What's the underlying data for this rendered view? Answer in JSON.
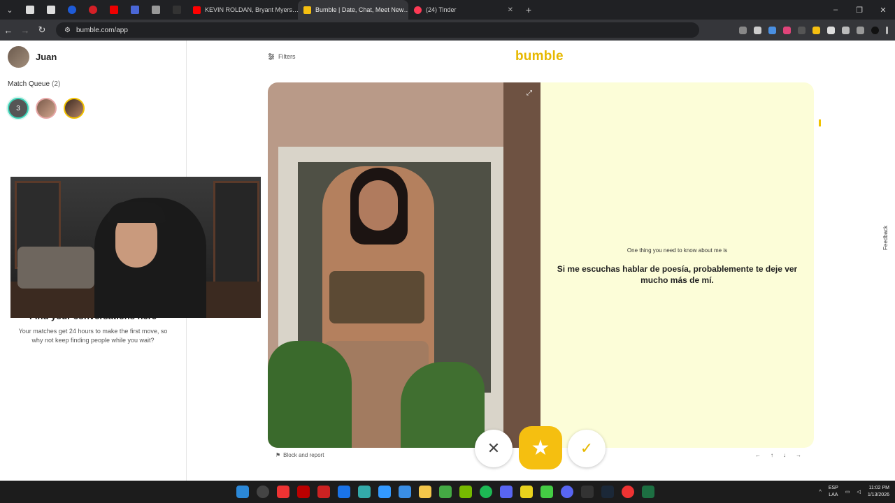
{
  "browser": {
    "tabs": [
      {
        "title": "KEVIN ROLDAN, Bryant Myers…",
        "color": "#ff0000",
        "active": false
      },
      {
        "title": "Bumble | Date, Chat, Meet New…",
        "color": "#f5bf10",
        "active": true
      },
      {
        "title": "(24) Tinder",
        "color": "#fd3a55",
        "active": false
      }
    ],
    "url": "bumble.com/app"
  },
  "sidebar": {
    "user_name": "Juan",
    "match_queue_label": "Match Queue",
    "match_queue_count": "(2)",
    "queue_badge": "3",
    "empty_title": "Find your conversations here",
    "empty_subtitle": "Your matches get 24 hours to make the first move, so why not keep finding people while you wait?"
  },
  "main": {
    "filters_label": "Filters",
    "logo_text": "bumble",
    "prompt_label": "One thing you need to know about me is",
    "prompt_answer": "Si me escuchas hablar de poesía, probablemente te deje ver mucho más de mí.",
    "block_report_label": "Block and report",
    "feedback_label": "Feedback"
  },
  "taskbar": {
    "language": "ESP",
    "language_sub": "LAA",
    "time": "11:02 PM",
    "date": "1/13/2026"
  },
  "colors": {
    "brand": "#f5bf10",
    "prompt_bg": "#fcfdd8"
  }
}
